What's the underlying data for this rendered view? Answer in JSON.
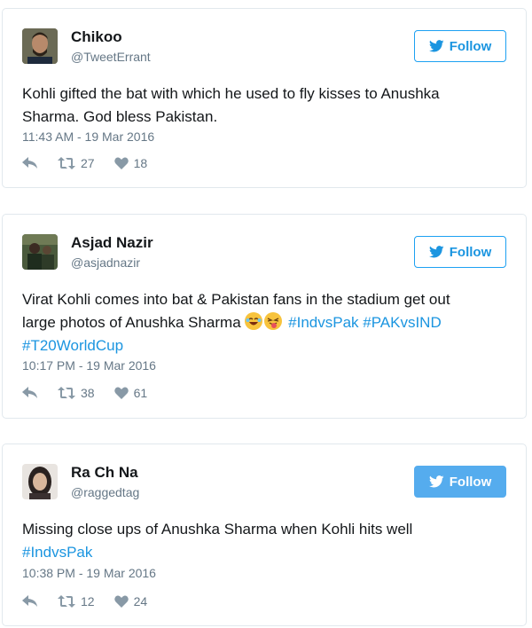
{
  "follow_label": "Follow",
  "tweets": [
    {
      "name": "Chikoo",
      "handle": "@TweetErrant",
      "text": "Kohli gifted the bat with which he used to fly kisses to Anushka Sharma. God bless Pakistan.",
      "time": "11:43 AM - 19 Mar 2016",
      "retweets": "27",
      "likes": "18"
    },
    {
      "name": "Asjad Nazir",
      "handle": "@asjadnazir",
      "text_line1": "Virat Kohli comes into bat & Pakistan fans in the stadium get out",
      "text_line2": "large photos of Anushka Sharma",
      "hashtags_line2": "#IndvsPak #PAKvsIND",
      "hashtags_line3": "#T20WorldCup",
      "time": "10:17 PM - 19 Mar 2016",
      "retweets": "38",
      "likes": "61"
    },
    {
      "name": "Ra Ch Na",
      "handle": "@raggedtag",
      "text": "Missing close ups of Anushka Sharma when Kohli hits well",
      "hashtag": "#IndvsPak",
      "time": "10:38 PM - 19 Mar 2016",
      "retweets": "12",
      "likes": "24"
    }
  ],
  "colors": {
    "link": "#1b95e0",
    "follow_active_bg": "#55acee"
  }
}
